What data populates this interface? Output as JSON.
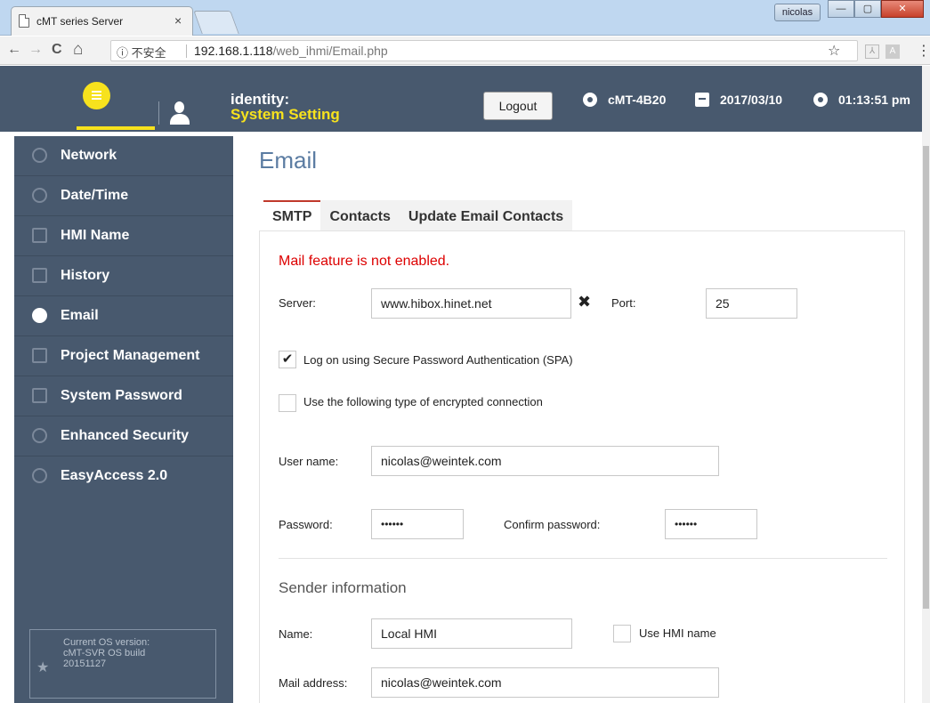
{
  "browser": {
    "tab_title": "cMT series Server",
    "tab_close": "×",
    "user_badge": "nicolas",
    "window_buttons": {
      "minimize": "—",
      "maximize": "▢",
      "close": "✕"
    },
    "nav": {
      "back": "←",
      "forward": "→",
      "reload": "C",
      "home": "⌂"
    },
    "security_label": "ⓘ 不安全",
    "url_host": "192.168.1.118",
    "url_path": "/web_ihmi/Email.php",
    "bookmark_icon": "☆",
    "ext1_label": "⅄",
    "ext2_label": "A",
    "menu_icon": "⋮"
  },
  "header": {
    "identity_label": "identity:",
    "identity_value": "System Setting",
    "logout_label": "Logout",
    "device_name": "cMT-4B20",
    "date": "2017/03/10",
    "time": "01:13:51 pm",
    "accent_color": "#f7e21d",
    "bg_color": "#48596e"
  },
  "sidebar": {
    "items": [
      {
        "label": "Network",
        "icon": "ip-icon"
      },
      {
        "label": "Date/Time",
        "icon": "clock-icon"
      },
      {
        "label": "HMI Name",
        "icon": "pencil-icon"
      },
      {
        "label": "History",
        "icon": "document-icon"
      },
      {
        "label": "Email",
        "icon": "email-user-icon",
        "active": true
      },
      {
        "label": "Project Management",
        "icon": "project-icon"
      },
      {
        "label": "System Password",
        "icon": "lock-icon"
      },
      {
        "label": "Enhanced Security",
        "icon": "users-icon"
      },
      {
        "label": "EasyAccess 2.0",
        "icon": "easyaccess-icon"
      }
    ],
    "os_version_line1": "Current OS version:",
    "os_version_line2": "cMT-SVR OS build",
    "os_version_line3": "20151127",
    "os_star": "★"
  },
  "main": {
    "title": "Email",
    "tabs": [
      "SMTP",
      "Contacts",
      "Update Email Contacts"
    ],
    "warning": "Mail feature is not enabled.",
    "server_label": "Server:",
    "server_value": "www.hibox.hinet.net",
    "clear_icon": "✖",
    "port_label": "Port:",
    "port_value": "25",
    "spa_label": "Log on using Secure Password Authentication (SPA)",
    "spa_checked": true,
    "encrypt_label": "Use the following type of encrypted connection",
    "encrypt_checked": false,
    "checkmark": "✔",
    "username_label": "User name:",
    "username_value": "nicolas@weintek.com",
    "password_label": "Password:",
    "password_value": "••••••",
    "confirm_label": "Confirm password:",
    "confirm_value": "••••••",
    "sender_title": "Sender information",
    "name_label": "Name:",
    "name_value": "Local HMI",
    "use_hmi_label": "Use HMI name",
    "use_hmi_checked": false,
    "mail_label": "Mail address:",
    "mail_value": "nicolas@weintek.com",
    "warning_color": "#dd0000"
  }
}
